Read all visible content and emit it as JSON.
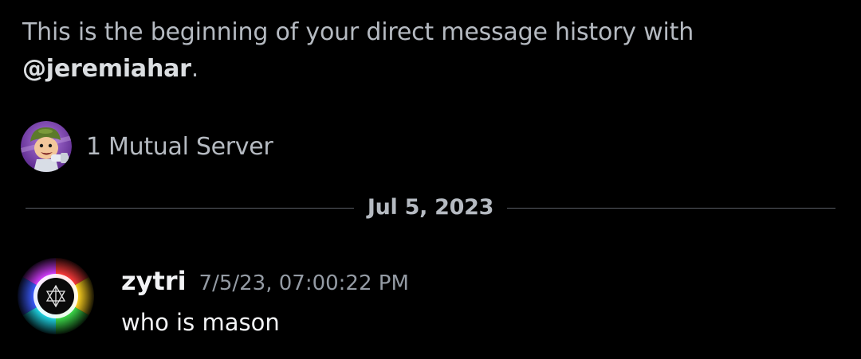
{
  "intro": {
    "prefix": "This is the beginning of your direct message history with",
    "mention": "@jeremiahar",
    "suffix": "."
  },
  "mutual_servers": {
    "label": "1 Mutual Server",
    "icon": "soldier-mascot-server-icon"
  },
  "divider": {
    "date": "Jul 5, 2023"
  },
  "message": {
    "author": "zytri",
    "timestamp": "7/5/23, 07:00:22 PM",
    "content": "who is mason",
    "avatar_icon": "rainbow-ring-star-avatar"
  },
  "colors": {
    "background": "#000000",
    "muted_text": "#b5bac1",
    "mention_text": "#dbdee1",
    "primary_text": "#f2f3f5",
    "timestamp_text": "#949ba4",
    "divider_line": "#5a5e66"
  }
}
